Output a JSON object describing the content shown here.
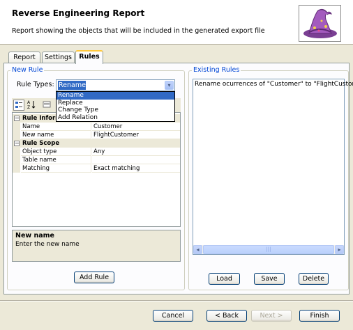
{
  "header": {
    "title": "Reverse Engineering Report",
    "subtitle": "Report showing the objects that will be included in the generated export file",
    "icon": "wizard-hat-icon"
  },
  "tabs": [
    {
      "label": "Report",
      "active": false
    },
    {
      "label": "Settings",
      "active": false
    },
    {
      "label": "Rules",
      "active": true
    }
  ],
  "new_rule": {
    "group_label": "New Rule",
    "rule_types_label": "Rule Types:",
    "rule_type_value": "Rename",
    "dropdown_options": [
      "Rename",
      "Replace",
      "Change Type",
      "Add Relation"
    ],
    "dropdown_selected_index": 0,
    "property_grid": {
      "categories": [
        {
          "name": "Rule Information",
          "rows": [
            {
              "key": "Name",
              "value": "Customer"
            },
            {
              "key": "New name",
              "value": "FlightCustomer"
            }
          ]
        },
        {
          "name": "Rule Scope",
          "rows": [
            {
              "key": "Object type",
              "value": "Any"
            },
            {
              "key": "Table name",
              "value": ""
            },
            {
              "key": "Matching",
              "value": "Exact matching"
            }
          ]
        }
      ]
    },
    "help": {
      "title": "New name",
      "description": "Enter the new name"
    },
    "add_button": "Add Rule"
  },
  "existing_rules": {
    "group_label": "Existing Rules",
    "items": [
      "Rename ocurrences of \"Customer\" to \"FlightCustomer\""
    ],
    "buttons": {
      "load": "Load",
      "save": "Save",
      "delete": "Delete"
    }
  },
  "footer": {
    "cancel": "Cancel",
    "back": "< Back",
    "next": "Next >",
    "finish": "Finish"
  },
  "colors": {
    "accent": "#316AC5",
    "group_label": "#0046D5",
    "tab_highlight": "#FFC83C"
  }
}
